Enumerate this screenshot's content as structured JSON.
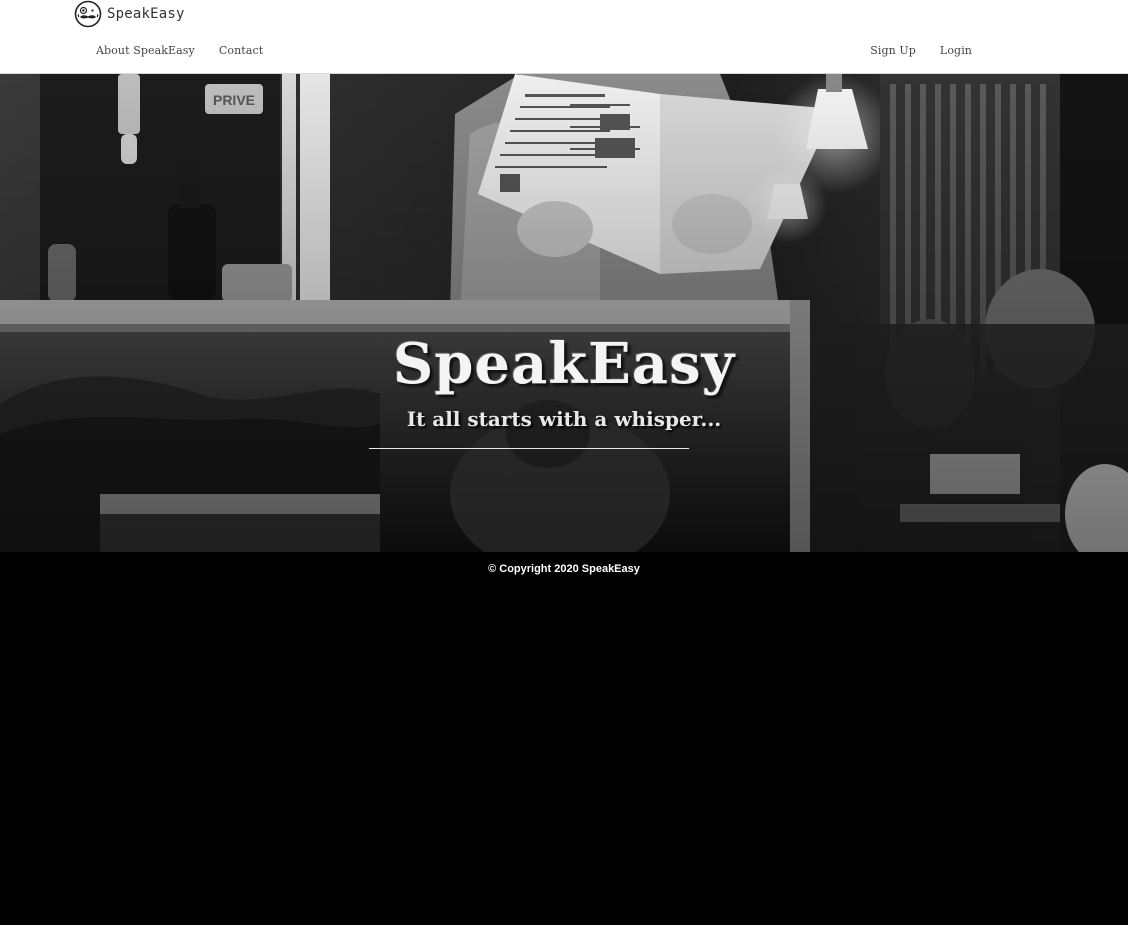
{
  "brand": {
    "name": "SpeakEasy",
    "logo_icon": "mustache-face-icon"
  },
  "nav": {
    "left": [
      {
        "label": "About SpeakEasy"
      },
      {
        "label": "Contact"
      }
    ],
    "right": [
      {
        "label": "Sign Up"
      },
      {
        "label": "Login"
      }
    ]
  },
  "hero": {
    "title": "SpeakEasy",
    "subtitle": "It all starts with a whisper...",
    "background": "black-and-white photo of a woman reading a menu through a cafe window"
  },
  "footer": {
    "copyright": "© Copyright 2020 SpeakEasy"
  },
  "colors": {
    "navbar_bg": "#ffffff",
    "nav_text": "#444444",
    "page_bg": "#000000",
    "hero_text": "#f4f4f4"
  }
}
